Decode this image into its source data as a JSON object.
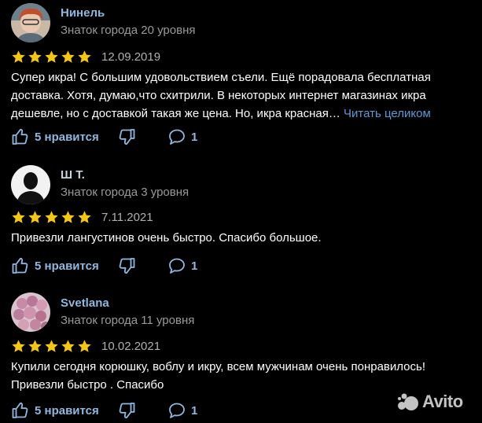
{
  "reviews": [
    {
      "author": "Нинель",
      "level": "Знаток города 20 уровня",
      "rating": 5,
      "date": "12.09.2019",
      "text": "Супер икра! С большим удовольствием съели. Ещё порадовала бесплатная доставка. Хотя, думаю,что схитрили. В некоторых интернет магазинах икра дешевле, но с доставкой такая же цена. Но, икра красная…",
      "more_label": "Читать целиком",
      "likes_label": "5 нравится",
      "comments": "1"
    },
    {
      "author": "Ш Т.",
      "level": "Знаток города 3 уровня",
      "rating": 5,
      "date": "7.11.2021",
      "text": "Привезли лангустинов очень быстро. Спасибо большое.",
      "likes_label": "5 нравится",
      "comments": "1"
    },
    {
      "author": "Svetlana",
      "level": "Знаток города 11 уровня",
      "rating": 5,
      "date": "10.02.2021",
      "text": "Купили сегодня корюшку, воблу и икру, всем мужчинам очень понравилось! Привезли быстро . Спасибо",
      "likes_label": "5 нравится",
      "comments": "1"
    }
  ],
  "watermark": "Avito",
  "colors": {
    "background": "#000000",
    "star": "#f5c518",
    "link": "#5d9ad6",
    "action": "#8fb8e0"
  }
}
